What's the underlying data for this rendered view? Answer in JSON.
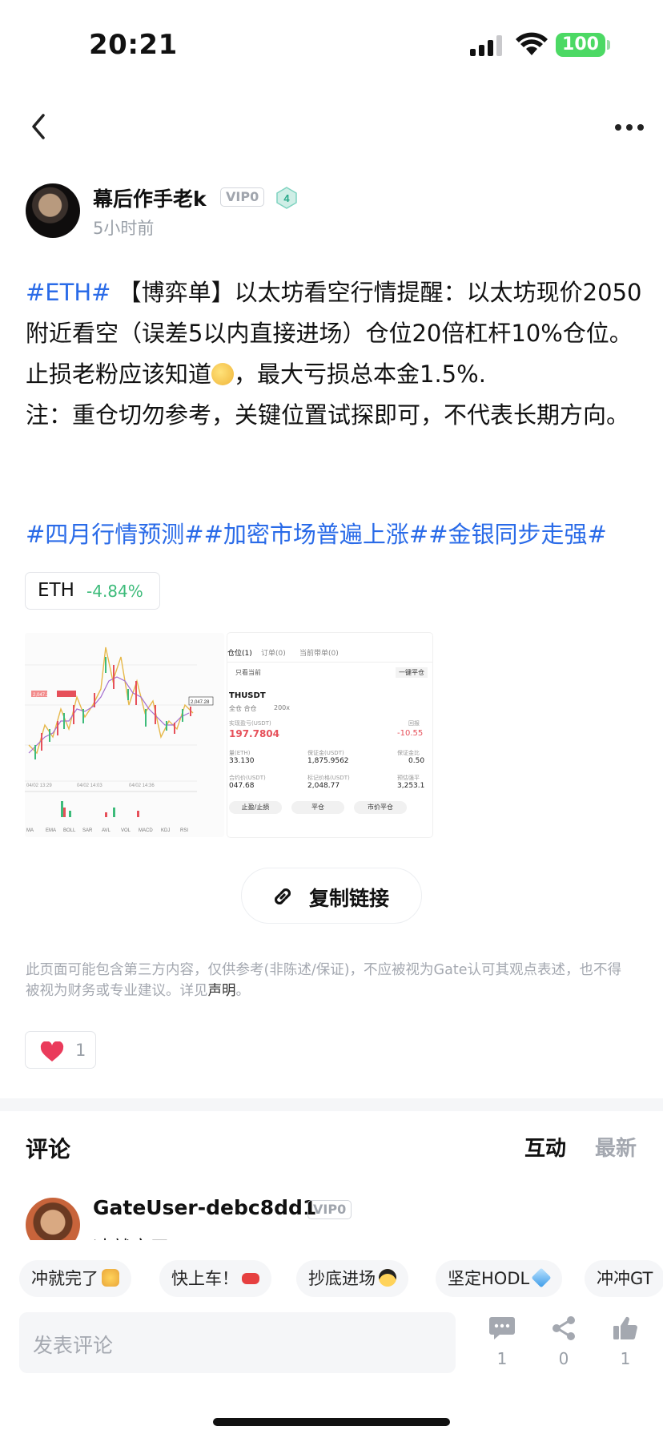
{
  "status_bar": {
    "time": "20:21",
    "battery": "100"
  },
  "author": {
    "name": "幕后作手老k",
    "vip": "VIP0",
    "level": "4",
    "time": "5小时前"
  },
  "post": {
    "hashtag_eth": "#ETH#",
    "body_1": " 【博弈单】以太坊看空行情提醒：以太坊现价2050附近看空（误差5以内直接进场）仓位20倍杠杆10%仓位。止损老粉应该知道",
    "body_2": "，最大亏损总本金1.5%.",
    "body_3": "注：重仓切勿参考，关键位置试探即可，不代表长期方向。",
    "tags": "#四月行情预测##加密市场普遍上涨##金银同步走强#"
  },
  "ticker": {
    "symbol": "ETH",
    "change": "-4.84%"
  },
  "screenshot_positions": {
    "tabs": [
      "仓位(1)",
      "订单(0)",
      "当前带单(0)"
    ],
    "only_current": "只看当前",
    "close_all": "一键平仓",
    "pair": "THUSDT",
    "mode": "全仓 合仓",
    "leverage": "200x",
    "pnl_label": "实现盈亏(USDT)",
    "pnl": "197.7804",
    "roi_label": "回报",
    "roi": "-10.55",
    "row1_labels": [
      "量(ETH)",
      "保证金(USDT)",
      "保证金比"
    ],
    "row1_values": [
      "33.130",
      "1,875.9562",
      "0.50"
    ],
    "row2_labels": [
      "合约价(USDT)",
      "标记价格(USDT)",
      "预估强平"
    ],
    "row2_values": [
      "047.68",
      "2,048.77",
      "3,253.1"
    ],
    "buttons": [
      "止盈/止损",
      "平仓",
      "市价平仓"
    ]
  },
  "screenshot_chart": {
    "price_tag_1": "2,047.28",
    "price_tag_2": "2,047.28",
    "dates": [
      "04/02 13:29",
      "04/02 14:03",
      "04/02 14:36"
    ],
    "indicators": [
      "MA",
      "EMA",
      "BOLL",
      "SAR",
      "AVL",
      "VOL",
      "MACD",
      "KDJ",
      "RSI"
    ]
  },
  "copy_link_label": "复制链接",
  "disclaimer": {
    "text": "此页面可能包含第三方内容，仅供参考(非陈述/保证)，不应被视为Gate认可其观点表述，也不得被视为财务或专业建议。详见",
    "link": "声明",
    "end": "。"
  },
  "likes": {
    "count": "1"
  },
  "comments": {
    "title": "评论",
    "tab_interact": "互动",
    "tab_latest": "最新",
    "first": {
      "user": "GateUser-debc8dd1",
      "vip": "VIP0",
      "text": "冲就完了"
    }
  },
  "quick_replies": [
    {
      "label": "冲就完了",
      "emoji": "fist"
    },
    {
      "label": "快上车！",
      "emoji": "car"
    },
    {
      "label": "抄底进场",
      "emoji": "sunglasses"
    },
    {
      "label": "坚定HODL",
      "emoji": "gem"
    },
    {
      "label": "冲冲GT",
      "emoji": ""
    }
  ],
  "comment_input": {
    "placeholder": "发表评论"
  },
  "actions": {
    "comment_count": "1",
    "share_count": "0",
    "like_count": "1"
  },
  "colors": {
    "hashtag": "#2a6be8",
    "down": "#3dbb7a",
    "heart": "#ea3b5b"
  }
}
